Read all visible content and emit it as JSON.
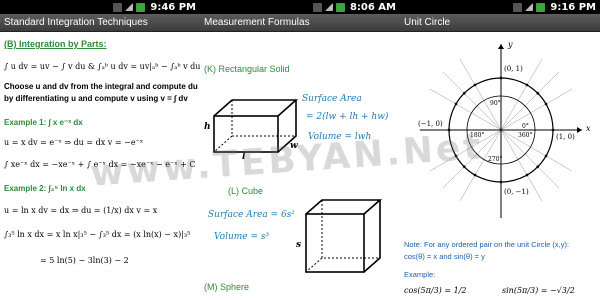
{
  "screens": [
    {
      "status_time": "9:46 PM",
      "title": "Standard Integration Techniques",
      "section": "(B) Integration by Parts:",
      "formula_1": "∫ u dv = uv − ∫ v du  &  ∫ₐᵇ u dv = uv|ₐᵇ − ∫ₐᵇ v du.",
      "desc_1": "Choose u and dv from the integral and compute du",
      "desc_2": "by differentiating u and compute v using   v = ∫ dv",
      "example_1": "Example 1: ∫ x e⁻ˣ dx",
      "ex1_line1": "u = x      dv = e⁻ˣ   ⇒  du = dx       v = −e⁻ˣ",
      "ex1_line2": "∫ xe⁻ˣ dx = −xe⁻ˣ + ∫ e⁻ˣ dx = −xe⁻ˣ − e⁻ˣ + C",
      "example_2": "Example 2: ∫₃⁵ ln x  dx",
      "ex2_line1": "u = ln x       dv = dx     ⇒   du = (1/x) dx       v = x",
      "ex2_line2": "∫₃⁵ ln x dx = x ln x|₃⁵ − ∫₃⁵ dx = (x ln(x) − x)|₃⁵",
      "ex2_line3": "= 5 ln(5) − 3ln(3) − 2"
    },
    {
      "status_time": "8:06 AM",
      "title": "Measurement Formulas",
      "k_title": "(K) Rectangular Solid",
      "k_surface_label": "Surface Area",
      "k_surface": "= 2(lw + lh + hw)",
      "k_volume": "Volume = lwh",
      "k_h": "h",
      "k_l": "l",
      "k_w": "w",
      "l_title": "(L) Cube",
      "l_surface": "Surface Area = 6s²",
      "l_volume": "Volume = s³",
      "l_s": "s",
      "m_title": "(M) Sphere"
    },
    {
      "status_time": "9:16 PM",
      "title": "Unit Circle",
      "axis_y": "y",
      "axis_x": "x",
      "pt_top": "(0, 1)",
      "pt_bottom": "(0, −1)",
      "pt_left": "(−1, 0)",
      "pt_right": "(1, 0)",
      "deg_90": "90°",
      "deg_180": "180°",
      "deg_270": "270°",
      "deg_0": "0°",
      "deg_360": "360°",
      "note_1": "Note: For any ordered pair on the unit Circle (x,y):",
      "note_2": "cos(θ) = x and sin(θ) = y",
      "example": "Example:",
      "ex_cos": "cos(5π/3) = 1/2",
      "ex_sin": "sin(5π/3) = −√3/2"
    }
  ],
  "watermark": "www.TEBYAN.Net",
  "colors": {
    "heading_green": "#2e8b3a",
    "formula_blue": "#1f7ab8",
    "titlebar": "#4a4a4a"
  },
  "icons": [
    "signal-bars-icon",
    "network-3g-icon",
    "battery-icon"
  ]
}
